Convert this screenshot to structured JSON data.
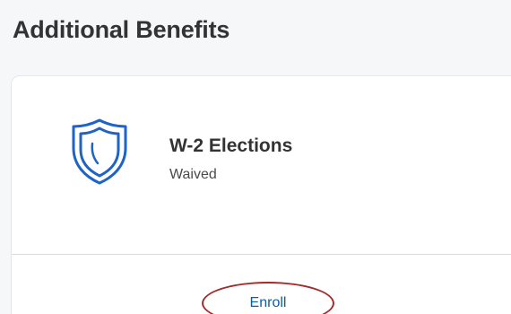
{
  "section": {
    "title": "Additional Benefits"
  },
  "card": {
    "icon": "shield-icon",
    "title": "W-2 Elections",
    "status": "Waived",
    "action_label": "Enroll",
    "colors": {
      "icon": "#1f63c6",
      "action_text": "#0b5cab",
      "highlight_ring": "#a52a2a"
    }
  }
}
